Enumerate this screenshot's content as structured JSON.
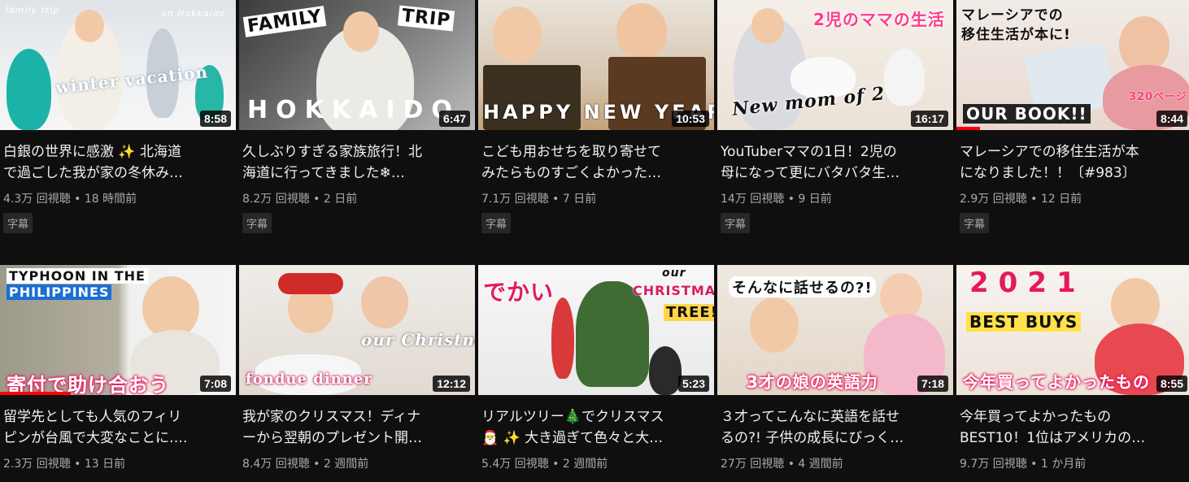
{
  "videos": [
    {
      "title_l1": "白銀の世界に感激 ✨ 北海道",
      "title_l2": "で過ごした我が家の冬休み…",
      "meta": "4.3万 回視聴 • 18 時間前",
      "badge": "字幕",
      "duration": "8:58",
      "caption": "winter vacation",
      "caption2": "family trip",
      "caption3": "on Hokkaido"
    },
    {
      "title_l1": "久しぶりすぎる家族旅行！北",
      "title_l2": "海道に行ってきました❄…",
      "meta": "8.2万 回視聴 • 2 日前",
      "badge": "字幕",
      "duration": "6:47",
      "caption": "FAMILY",
      "caption2": "TRIP",
      "caption3": "HOKKAIDO"
    },
    {
      "title_l1": "こども用おせちを取り寄せて",
      "title_l2": "みたらものすごくよかった…",
      "meta": "7.1万 回視聴 • 7 日前",
      "badge": "字幕",
      "duration": "10:53",
      "caption": "HAPPY NEW YEAR"
    },
    {
      "title_l1": "YouTuberママの1日！2児の",
      "title_l2": "母になって更にバタバタ生…",
      "meta": "14万 回視聴 • 9 日前",
      "badge": "字幕",
      "duration": "16:17",
      "caption": "2児のママの生活",
      "caption2": "New mom of 2"
    },
    {
      "title_l1": "マレーシアでの移住生活が本",
      "title_l2": "になりました！！〔#983〕",
      "meta": "2.9万 回視聴 • 12 日前",
      "badge": "字幕",
      "duration": "8:44",
      "caption": "マレーシアでの",
      "caption2": "移住生活が本に!",
      "caption3": "OUR BOOK!!",
      "caption4": "320ページ",
      "progress": 0.1
    },
    {
      "title_l1": "留学先としても人気のフィリ",
      "title_l2": "ピンが台風で大変なことに….",
      "meta": "2.3万 回視聴 • 13 日前",
      "duration": "7:08",
      "caption": "TYPHOON IN THE",
      "caption2": "PHILIPPINES",
      "caption3": "寄付で助け合おう",
      "progress": 0.3
    },
    {
      "title_l1": "我が家のクリスマス！ディナ",
      "title_l2": "ーから翌朝のプレゼント開…",
      "meta": "8.4万 回視聴 • 2 週間前",
      "duration": "12:12",
      "caption": "fondue dinner",
      "caption2": "our Christmas"
    },
    {
      "title_l1": "リアルツリー🎄でクリスマス",
      "title_l2": "🎅 ✨ 大き過ぎて色々と大…",
      "meta": "5.4万 回視聴 • 2 週間前",
      "duration": "5:23",
      "caption": "でかい",
      "caption2": "our",
      "caption3": "CHRISTMAS",
      "caption4": "TREE!"
    },
    {
      "title_l1": "３才ってこんなに英語を話せ",
      "title_l2": "るの?! 子供の成長にびっく…",
      "meta": "27万 回視聴 • 4 週間前",
      "duration": "7:18",
      "caption": "そんなに話せるの?!",
      "caption2": "3才の娘の英語力"
    },
    {
      "title_l1": "今年買ってよかったもの",
      "title_l2": "BEST10！1位はアメリカの…",
      "meta": "9.7万 回視聴 • 1 か月前",
      "duration": "8:55",
      "caption": "2021",
      "caption2": "BEST BUYS",
      "caption3": "今年買ってよかったもの"
    }
  ],
  "colors": {
    "background": "#0f0f0f",
    "text": "#f1f1f1",
    "meta": "#aaaaaa",
    "progress": "#ff0000"
  }
}
